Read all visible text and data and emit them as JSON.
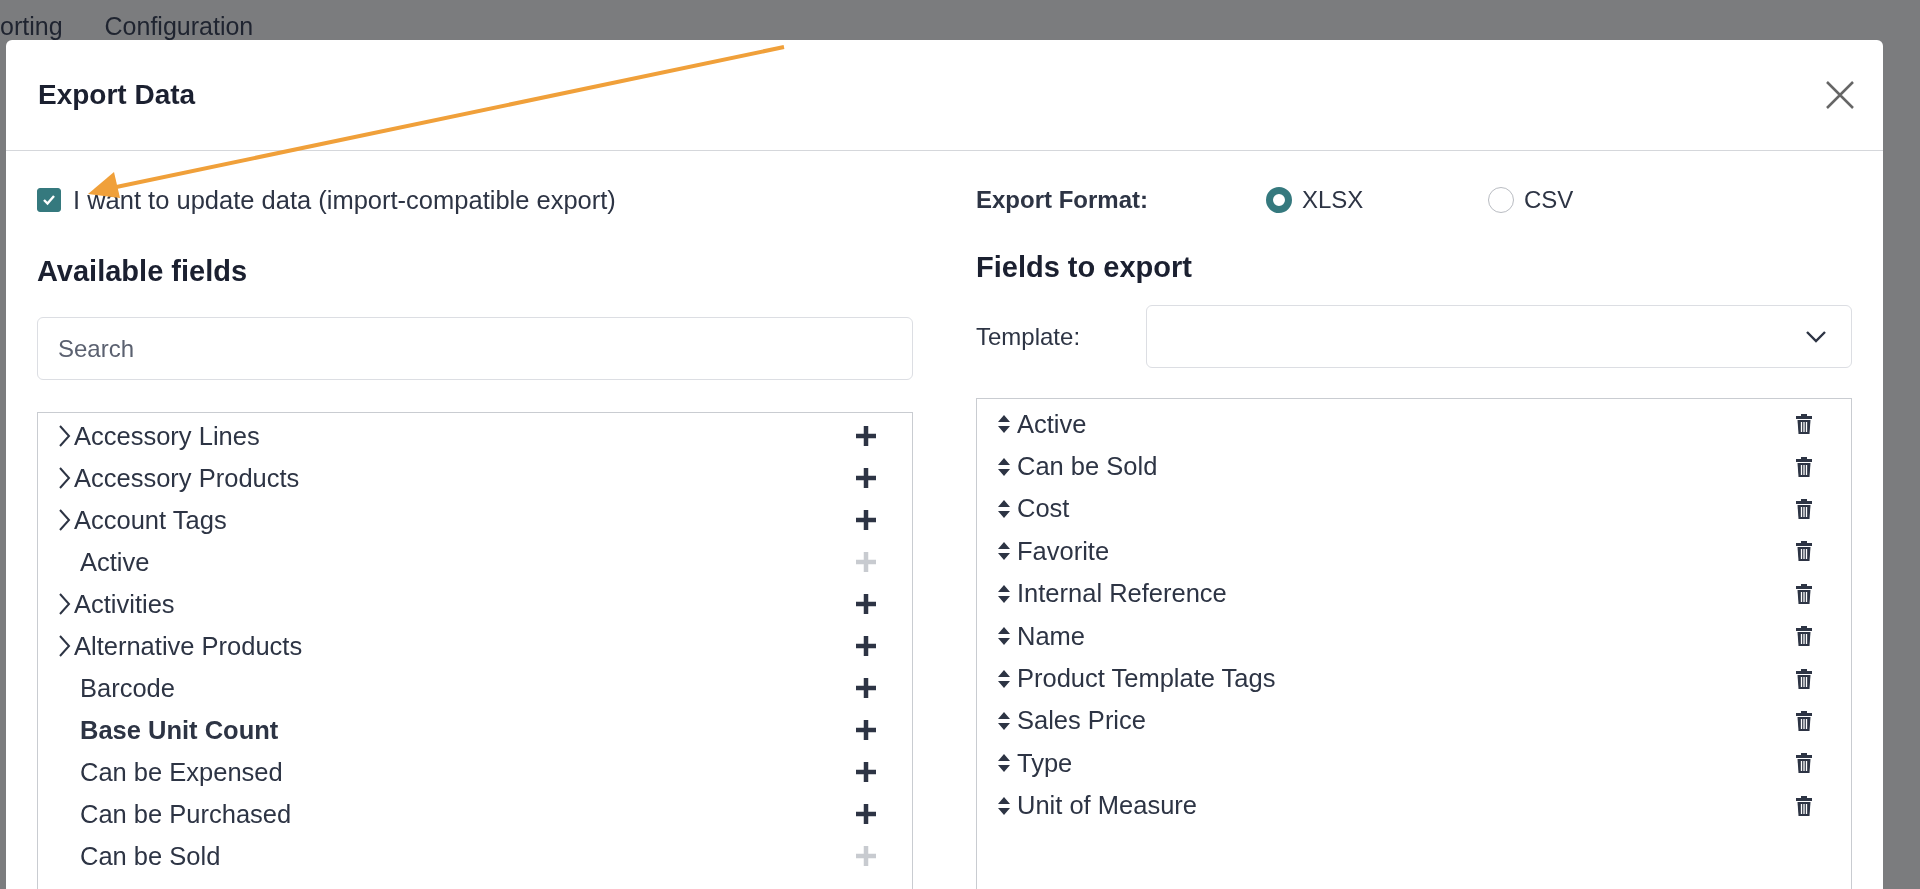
{
  "background_menu": [
    "orting",
    "Configuration"
  ],
  "dialog": {
    "title": "Export Data",
    "import_compatible": {
      "label": "I want to update data (import-compatible export)",
      "checked": true
    },
    "export_format": {
      "label": "Export Format:",
      "options": [
        {
          "label": "XLSX",
          "selected": true
        },
        {
          "label": "CSV",
          "selected": false
        }
      ]
    },
    "available_fields": {
      "heading": "Available fields",
      "search": {
        "placeholder": "Search"
      },
      "items": [
        {
          "label": "Accessory Lines",
          "expandable": true,
          "disabled": false,
          "required": false
        },
        {
          "label": "Accessory Products",
          "expandable": true,
          "disabled": false,
          "required": false
        },
        {
          "label": "Account Tags",
          "expandable": true,
          "disabled": false,
          "required": false
        },
        {
          "label": "Active",
          "expandable": false,
          "disabled": true,
          "required": false
        },
        {
          "label": "Activities",
          "expandable": true,
          "disabled": false,
          "required": false
        },
        {
          "label": "Alternative Products",
          "expandable": true,
          "disabled": false,
          "required": false
        },
        {
          "label": "Barcode",
          "expandable": false,
          "disabled": false,
          "required": false
        },
        {
          "label": "Base Unit Count",
          "expandable": false,
          "disabled": false,
          "required": true
        },
        {
          "label": "Can be Expensed",
          "expandable": false,
          "disabled": false,
          "required": false
        },
        {
          "label": "Can be Purchased",
          "expandable": false,
          "disabled": false,
          "required": false
        },
        {
          "label": "Can be Sold",
          "expandable": false,
          "disabled": true,
          "required": false
        }
      ]
    },
    "fields_to_export": {
      "heading": "Fields to export",
      "template_label": "Template:",
      "items": [
        "Active",
        "Can be Sold",
        "Cost",
        "Favorite",
        "Internal Reference",
        "Name",
        "Product Template Tags",
        "Sales Price",
        "Type",
        "Unit of Measure"
      ]
    }
  }
}
